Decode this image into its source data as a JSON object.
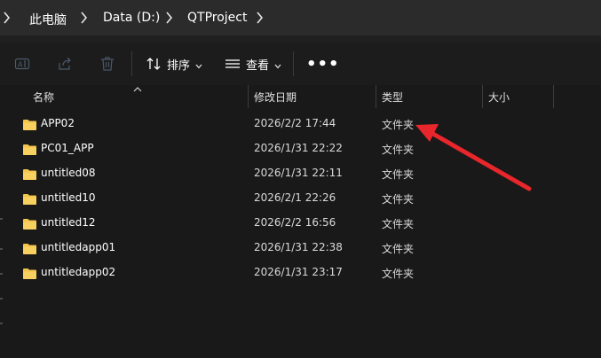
{
  "breadcrumb": {
    "items": [
      "此电脑",
      "Data (D:)",
      "QTProject"
    ]
  },
  "toolbar": {
    "sort_label": "排序",
    "view_label": "查看",
    "more_label": "•••"
  },
  "columns": {
    "name": "名称",
    "modified": "修改日期",
    "type": "类型",
    "size": "大小"
  },
  "files": [
    {
      "name": "APP02",
      "modified": "2026/2/2 17:44",
      "type": "文件夹",
      "size": ""
    },
    {
      "name": "PC01_APP",
      "modified": "2026/1/31 22:22",
      "type": "文件夹",
      "size": ""
    },
    {
      "name": "untitled08",
      "modified": "2026/1/31 22:11",
      "type": "文件夹",
      "size": ""
    },
    {
      "name": "untitled10",
      "modified": "2026/2/1 22:26",
      "type": "文件夹",
      "size": ""
    },
    {
      "name": "untitled12",
      "modified": "2026/2/2 16:56",
      "type": "文件夹",
      "size": ""
    },
    {
      "name": "untitledapp01",
      "modified": "2026/1/31 22:38",
      "type": "文件夹",
      "size": ""
    },
    {
      "name": "untitledapp02",
      "modified": "2026/1/31 23:17",
      "type": "文件夹",
      "size": ""
    }
  ],
  "icons": {
    "folder": "folder-icon",
    "rename": "rename-icon",
    "share": "share-icon",
    "delete": "delete-icon",
    "sort": "sort-icon",
    "view": "view-icon"
  },
  "colors": {
    "folder": "#f3c44b",
    "annotation_arrow": "#e8262b",
    "background": "#191919"
  }
}
